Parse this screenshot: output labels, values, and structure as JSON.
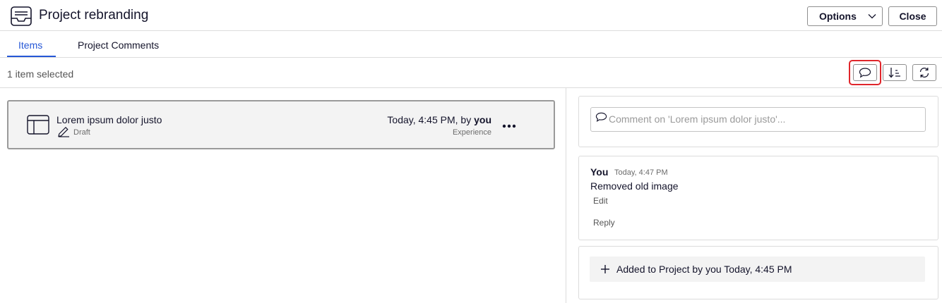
{
  "header": {
    "title": "Project rebranding",
    "icon": "inbox-tray-icon",
    "options_label": "Options",
    "close_label": "Close"
  },
  "tabs": [
    {
      "label": "Items",
      "active": true
    },
    {
      "label": "Project Comments",
      "active": false
    }
  ],
  "toolbar": {
    "selected_text": "1 item selected",
    "buttons": [
      "comment-icon",
      "sort-icon",
      "refresh-icon"
    ]
  },
  "item": {
    "title": "Lorem ipsum dolor justo",
    "status": "Draft",
    "date_prefix": "Today, 4:45 PM, by ",
    "author": "you",
    "type": "Experience"
  },
  "comments": {
    "placeholder": "Comment on 'Lorem ipsum dolor justo'...",
    "entries": [
      {
        "author": "You",
        "time": "Today, 4:47 PM",
        "text": "Removed old image",
        "edit_label": "Edit",
        "reply_label": "Reply"
      }
    ],
    "activity": "Added to Project by you Today, 4:45 PM"
  },
  "colors": {
    "accent": "#2557d6",
    "highlight": "#e0262b",
    "text": "#14142b"
  }
}
